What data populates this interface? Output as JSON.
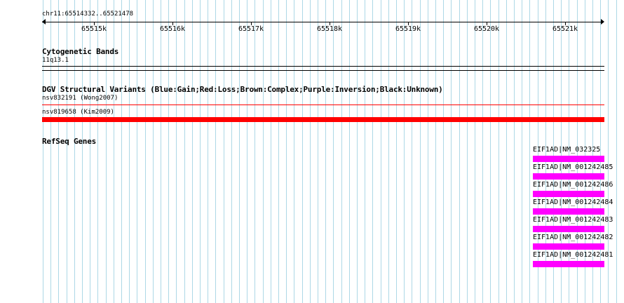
{
  "ruler": {
    "location": "chr11:65514332..65521478",
    "ticks": [
      "65515k",
      "65516k",
      "65517k",
      "65518k",
      "65519k",
      "65520k",
      "65521k"
    ]
  },
  "tracks": {
    "cytoband": {
      "title": "Cytogenetic Bands",
      "band_label": "11q13.1"
    },
    "dgv": {
      "title": "DGV Structural Variants (Blue:Gain;Red:Loss;Brown:Complex;Purple:Inversion;Black:Unknown)",
      "variants": [
        {
          "label": "nsv832191 (Wong2007)",
          "color": "#ff0000",
          "type": "Loss"
        },
        {
          "label": "nsv819658 (Kim2009)",
          "color": "#ff0000",
          "type": "Loss"
        }
      ]
    },
    "refseq": {
      "title": "RefSeq Genes",
      "color": "#ff00ff",
      "genes": [
        "EIF1AD|NM_032325",
        "EIF1AD|NM_001242485",
        "EIF1AD|NM_001242486",
        "EIF1AD|NM_001242484",
        "EIF1AD|NM_001242483",
        "EIF1AD|NM_001242482",
        "EIF1AD|NM_001242481"
      ]
    }
  },
  "colors": {
    "grid_line": "#add8e6",
    "variant_loss": "#ff0000",
    "gene_feature": "#ff00ff"
  }
}
